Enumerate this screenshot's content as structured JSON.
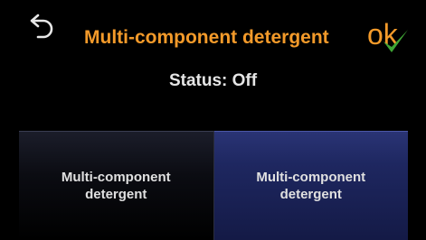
{
  "header": {
    "back_icon": "back-arrow-icon",
    "title": "Multi-component detergent",
    "ok_label": "ok",
    "ok_icon": "checkmark-icon",
    "accent_color": "#f39a2a",
    "check_color": "#3fa535"
  },
  "status": {
    "text": "Status: Off"
  },
  "options": [
    {
      "label": "Multi-component detergent",
      "selected": false
    },
    {
      "label": "Multi-component detergent",
      "selected": true
    }
  ]
}
